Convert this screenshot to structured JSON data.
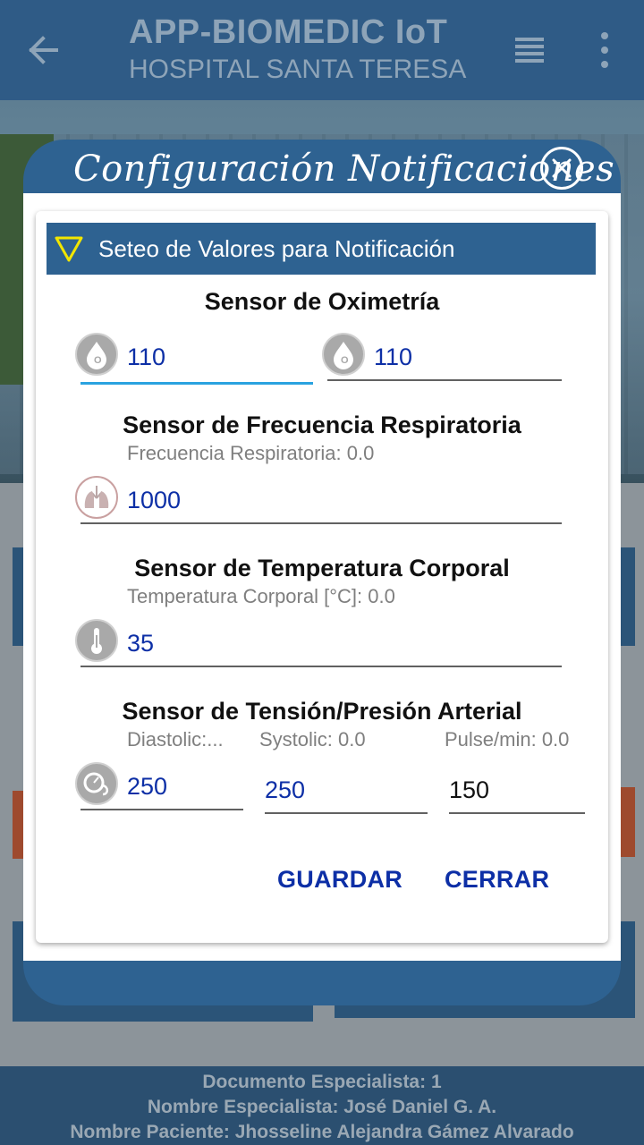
{
  "appbar": {
    "title": "APP-BIOMEDIC IoT",
    "subtitle": "HOSPITAL SANTA TERESA"
  },
  "footer": {
    "line1": "Documento Especialista: 1",
    "line2": "Nombre Especialista: José Daniel G. A.",
    "line3": "Nombre Paciente: Jhosseline Alejandra Gámez Alvarado"
  },
  "dialog": {
    "title": "Configuración Notificaciones",
    "section_label": "Seteo de Valores para Notificación",
    "oximetry": {
      "title": "Sensor de Oximetría",
      "value_1": "110",
      "value_2": "110"
    },
    "respiratory": {
      "title": "Sensor de Frecuencia Respiratoria",
      "reading": "Frecuencia Respiratoria: 0.0",
      "value": "1000"
    },
    "temperature": {
      "title": "Sensor de Temperatura Corporal",
      "reading": "Temperatura Corporal [°C]: 0.0",
      "value": "35"
    },
    "pressure": {
      "title": "Sensor de Tensión/Presión Arterial",
      "diastolic_label": "Diastolic:...",
      "systolic_label": "Systolic: 0.0",
      "pulse_label": "Pulse/min: 0.0",
      "diastolic_value": "250",
      "systolic_value": "250",
      "pulse_value": "150"
    },
    "save_label": "GUARDAR",
    "close_label": "CERRAR"
  },
  "colors": {
    "primary": "#2e6291",
    "input_text": "#0d2fa6",
    "focus_underline": "#2aa3e0",
    "section_icon": "#f2e600"
  }
}
